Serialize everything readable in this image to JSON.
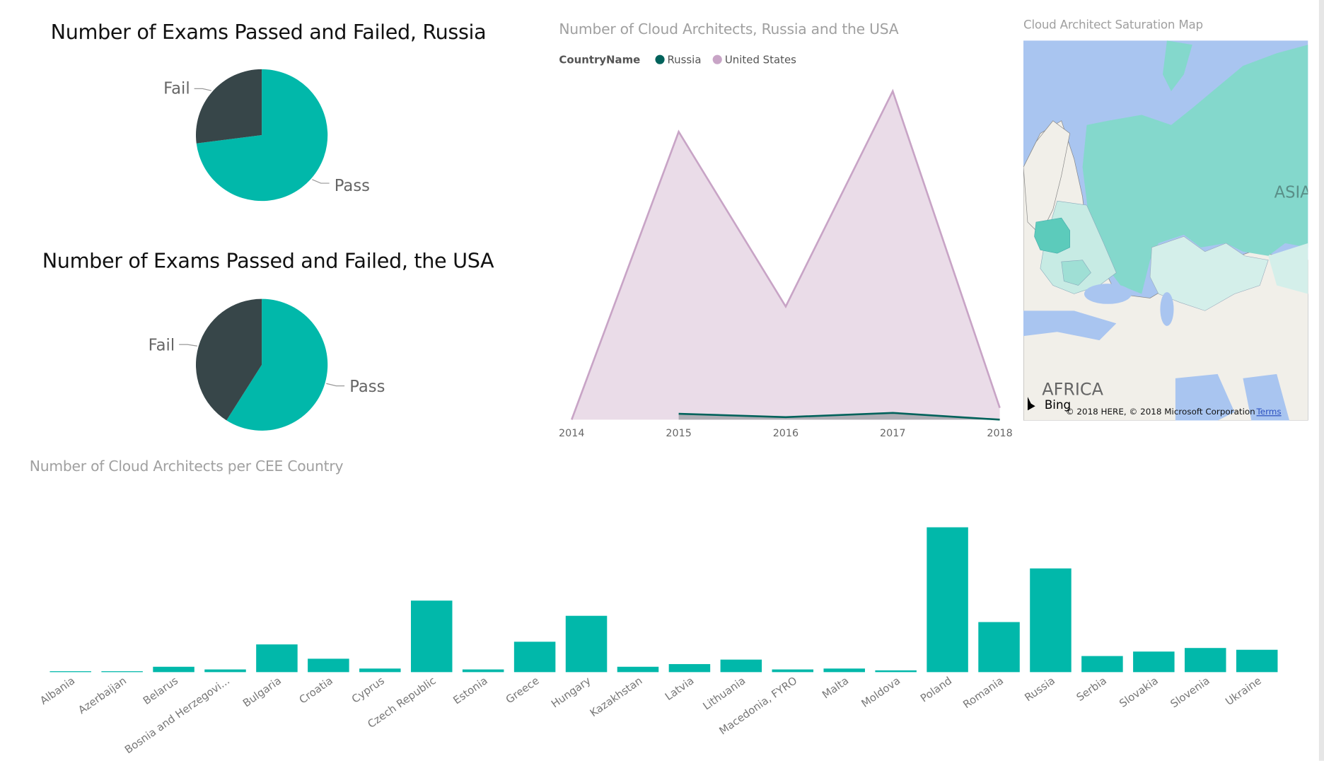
{
  "colors": {
    "pass": "#01b8aa",
    "fail": "#374649",
    "russia": "#01625b",
    "us": "#c8a4c6",
    "us_fill": "#eadce8",
    "bar": "#01b8aa"
  },
  "chart_data": [
    {
      "type": "pie",
      "title": "Number of Exams Passed and Failed, Russia",
      "slices": [
        {
          "label": "Pass",
          "value": 73
        },
        {
          "label": "Fail",
          "value": 27
        }
      ]
    },
    {
      "type": "pie",
      "title": "Number of Exams Passed and Failed, the USA",
      "slices": [
        {
          "label": "Pass",
          "value": 59
        },
        {
          "label": "Fail",
          "value": 41
        }
      ]
    },
    {
      "type": "area",
      "title": "Number of Cloud Architects, Russia and the USA",
      "legend_title": "CountryName",
      "legend_position": "top-left",
      "x": [
        "2014",
        "2015",
        "2016",
        "2017",
        "2018"
      ],
      "ylim": [
        0,
        400
      ],
      "series": [
        {
          "name": "Russia",
          "values": [
            null,
            7,
            3,
            8,
            0
          ]
        },
        {
          "name": "United States",
          "values": [
            0,
            341,
            134,
            389,
            14
          ]
        }
      ]
    },
    {
      "type": "bar",
      "title": "Number of Cloud Architects per CEE Country",
      "ylim": [
        0,
        170
      ],
      "categories": [
        "Albania",
        "Azerbaijan",
        "Belarus",
        "Bosnia and Herzegovi...",
        "Bulgaria",
        "Croatia",
        "Cyprus",
        "Czech Republic",
        "Estonia",
        "Greece",
        "Hungary",
        "Kazakhstan",
        "Latvia",
        "Lithuania",
        "Macedonia, FYRO",
        "Malta",
        "Moldova",
        "Poland",
        "Romania",
        "Russia",
        "Serbia",
        "Slovakia",
        "Slovenia",
        "Ukraine"
      ],
      "values": [
        1,
        1,
        6,
        3,
        31,
        15,
        4,
        80,
        3,
        34,
        63,
        6,
        9,
        14,
        3,
        4,
        2,
        162,
        56,
        116,
        18,
        23,
        27,
        25
      ]
    }
  ],
  "map": {
    "title": "Cloud Architect Saturation Map",
    "labels": {
      "asia": "ASIA",
      "africa": "AFRICA"
    },
    "bing": "Bing",
    "copyright": "© 2018 HERE, © 2018 Microsoft Corporation",
    "terms": "Terms"
  }
}
